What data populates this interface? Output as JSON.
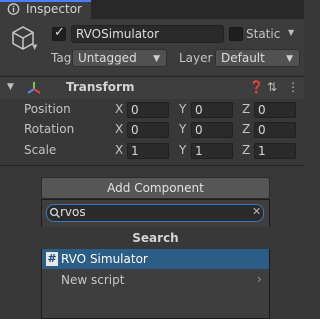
{
  "window": {
    "tab_title": "Inspector",
    "tab_icon": "info-icon"
  },
  "gameobject": {
    "icon": "cube-icon",
    "active": true,
    "name": "RVOSimulator",
    "static_label": "Static",
    "static_checked": false,
    "tag_label": "Tag",
    "tag_value": "Untagged",
    "layer_label": "Layer",
    "layer_value": "Default"
  },
  "transform": {
    "title": "Transform",
    "icon": "transform-axes-icon",
    "header_icons": [
      "help-icon",
      "presets-icon",
      "context-menu-icon"
    ],
    "rows": [
      {
        "label": "Position",
        "x": "0",
        "y": "0",
        "z": "0"
      },
      {
        "label": "Rotation",
        "x": "0",
        "y": "0",
        "z": "0"
      },
      {
        "label": "Scale",
        "x": "1",
        "y": "1",
        "z": "1"
      }
    ],
    "axis_labels": {
      "x": "X",
      "y": "Y",
      "z": "Z"
    }
  },
  "add_component": {
    "button_label": "Add Component",
    "search_value": "rvos",
    "search_icon": "search-icon",
    "clear_icon": "clear-icon",
    "popup_title": "Search",
    "items": [
      {
        "label": "RVO Simulator",
        "icon": "script-icon",
        "selected": true
      },
      {
        "label": "New script",
        "submenu": true
      }
    ]
  },
  "colors": {
    "selection": "#2c5d87",
    "focus_border": "#3a79bb",
    "tab_accent": "#4c7fff"
  }
}
